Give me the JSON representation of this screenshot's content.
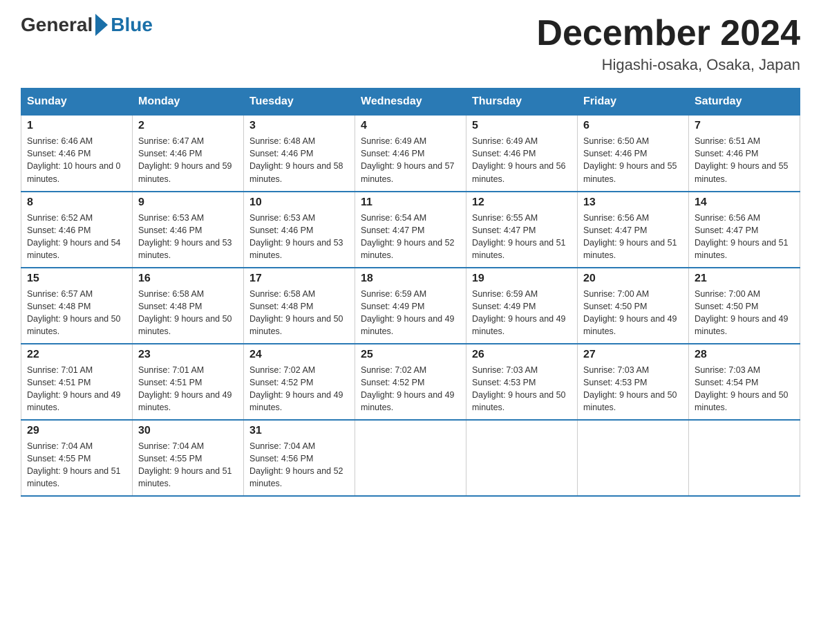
{
  "header": {
    "month_year": "December 2024",
    "location": "Higashi-osaka, Osaka, Japan",
    "logo_general": "General",
    "logo_blue": "Blue"
  },
  "weekdays": [
    "Sunday",
    "Monday",
    "Tuesday",
    "Wednesday",
    "Thursday",
    "Friday",
    "Saturday"
  ],
  "weeks": [
    [
      {
        "day": "1",
        "sunrise": "6:46 AM",
        "sunset": "4:46 PM",
        "daylight": "10 hours and 0 minutes."
      },
      {
        "day": "2",
        "sunrise": "6:47 AM",
        "sunset": "4:46 PM",
        "daylight": "9 hours and 59 minutes."
      },
      {
        "day": "3",
        "sunrise": "6:48 AM",
        "sunset": "4:46 PM",
        "daylight": "9 hours and 58 minutes."
      },
      {
        "day": "4",
        "sunrise": "6:49 AM",
        "sunset": "4:46 PM",
        "daylight": "9 hours and 57 minutes."
      },
      {
        "day": "5",
        "sunrise": "6:49 AM",
        "sunset": "4:46 PM",
        "daylight": "9 hours and 56 minutes."
      },
      {
        "day": "6",
        "sunrise": "6:50 AM",
        "sunset": "4:46 PM",
        "daylight": "9 hours and 55 minutes."
      },
      {
        "day": "7",
        "sunrise": "6:51 AM",
        "sunset": "4:46 PM",
        "daylight": "9 hours and 55 minutes."
      }
    ],
    [
      {
        "day": "8",
        "sunrise": "6:52 AM",
        "sunset": "4:46 PM",
        "daylight": "9 hours and 54 minutes."
      },
      {
        "day": "9",
        "sunrise": "6:53 AM",
        "sunset": "4:46 PM",
        "daylight": "9 hours and 53 minutes."
      },
      {
        "day": "10",
        "sunrise": "6:53 AM",
        "sunset": "4:46 PM",
        "daylight": "9 hours and 53 minutes."
      },
      {
        "day": "11",
        "sunrise": "6:54 AM",
        "sunset": "4:47 PM",
        "daylight": "9 hours and 52 minutes."
      },
      {
        "day": "12",
        "sunrise": "6:55 AM",
        "sunset": "4:47 PM",
        "daylight": "9 hours and 51 minutes."
      },
      {
        "day": "13",
        "sunrise": "6:56 AM",
        "sunset": "4:47 PM",
        "daylight": "9 hours and 51 minutes."
      },
      {
        "day": "14",
        "sunrise": "6:56 AM",
        "sunset": "4:47 PM",
        "daylight": "9 hours and 51 minutes."
      }
    ],
    [
      {
        "day": "15",
        "sunrise": "6:57 AM",
        "sunset": "4:48 PM",
        "daylight": "9 hours and 50 minutes."
      },
      {
        "day": "16",
        "sunrise": "6:58 AM",
        "sunset": "4:48 PM",
        "daylight": "9 hours and 50 minutes."
      },
      {
        "day": "17",
        "sunrise": "6:58 AM",
        "sunset": "4:48 PM",
        "daylight": "9 hours and 50 minutes."
      },
      {
        "day": "18",
        "sunrise": "6:59 AM",
        "sunset": "4:49 PM",
        "daylight": "9 hours and 49 minutes."
      },
      {
        "day": "19",
        "sunrise": "6:59 AM",
        "sunset": "4:49 PM",
        "daylight": "9 hours and 49 minutes."
      },
      {
        "day": "20",
        "sunrise": "7:00 AM",
        "sunset": "4:50 PM",
        "daylight": "9 hours and 49 minutes."
      },
      {
        "day": "21",
        "sunrise": "7:00 AM",
        "sunset": "4:50 PM",
        "daylight": "9 hours and 49 minutes."
      }
    ],
    [
      {
        "day": "22",
        "sunrise": "7:01 AM",
        "sunset": "4:51 PM",
        "daylight": "9 hours and 49 minutes."
      },
      {
        "day": "23",
        "sunrise": "7:01 AM",
        "sunset": "4:51 PM",
        "daylight": "9 hours and 49 minutes."
      },
      {
        "day": "24",
        "sunrise": "7:02 AM",
        "sunset": "4:52 PM",
        "daylight": "9 hours and 49 minutes."
      },
      {
        "day": "25",
        "sunrise": "7:02 AM",
        "sunset": "4:52 PM",
        "daylight": "9 hours and 49 minutes."
      },
      {
        "day": "26",
        "sunrise": "7:03 AM",
        "sunset": "4:53 PM",
        "daylight": "9 hours and 50 minutes."
      },
      {
        "day": "27",
        "sunrise": "7:03 AM",
        "sunset": "4:53 PM",
        "daylight": "9 hours and 50 minutes."
      },
      {
        "day": "28",
        "sunrise": "7:03 AM",
        "sunset": "4:54 PM",
        "daylight": "9 hours and 50 minutes."
      }
    ],
    [
      {
        "day": "29",
        "sunrise": "7:04 AM",
        "sunset": "4:55 PM",
        "daylight": "9 hours and 51 minutes."
      },
      {
        "day": "30",
        "sunrise": "7:04 AM",
        "sunset": "4:55 PM",
        "daylight": "9 hours and 51 minutes."
      },
      {
        "day": "31",
        "sunrise": "7:04 AM",
        "sunset": "4:56 PM",
        "daylight": "9 hours and 52 minutes."
      },
      null,
      null,
      null,
      null
    ]
  ],
  "labels": {
    "sunrise": "Sunrise:",
    "sunset": "Sunset:",
    "daylight": "Daylight:"
  }
}
